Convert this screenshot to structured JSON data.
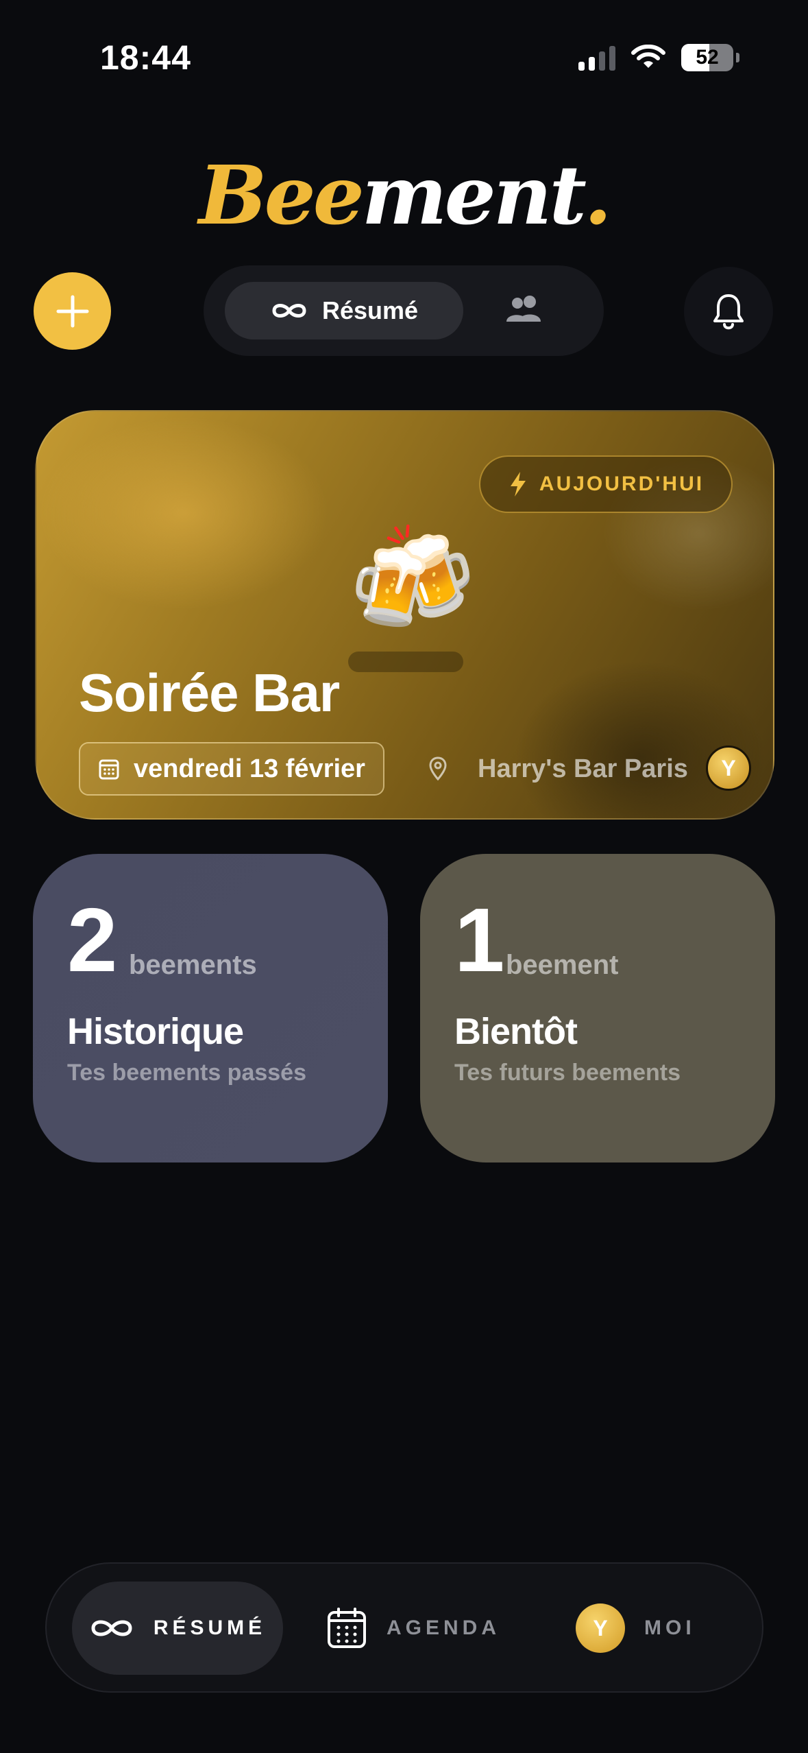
{
  "status_bar": {
    "time": "18:44",
    "battery": "52"
  },
  "logo": {
    "part1": "Bee",
    "part2": "ment",
    "dot": "."
  },
  "header": {
    "add_icon": "plus-icon",
    "segments": [
      {
        "label": "Résumé",
        "icon": "infinity-icon",
        "active": true
      },
      {
        "label": "",
        "icon": "people-icon",
        "active": false
      }
    ],
    "notifications_icon": "bell-icon"
  },
  "hero": {
    "badge": "AUJOURD'HUI",
    "emoji": "🍻",
    "title": "Soirée Bar",
    "date": "vendredi 13 février",
    "location": "Harry's Bar Paris",
    "avatar_initial": "Y"
  },
  "stats": {
    "history": {
      "count": "2",
      "unit": "beements",
      "title": "Historique",
      "subtitle": "Tes beements passés"
    },
    "upcoming": {
      "count": "1",
      "unit": "beement",
      "title": "Bientôt",
      "subtitle": "Tes futurs beements"
    }
  },
  "nav": {
    "summary": "RÉSUMÉ",
    "agenda": "AGENDA",
    "me": "MOI",
    "me_avatar_initial": "Y"
  },
  "colors": {
    "accent": "#f2c043",
    "background": "#0a0b0e"
  }
}
